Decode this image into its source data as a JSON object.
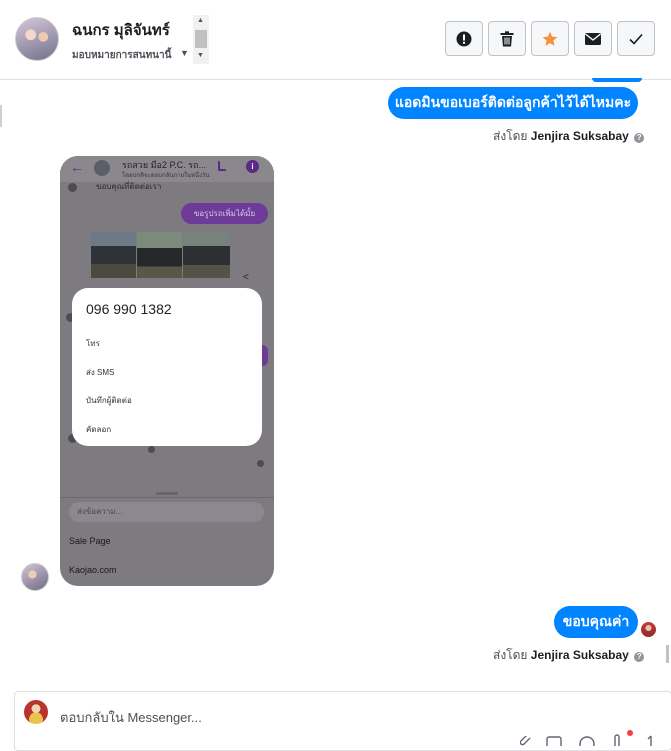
{
  "header": {
    "contact_name": "ฉนกร มุลิจันทร์",
    "assign_label": "มอบหมายการสนทนานี้"
  },
  "toolbar": {
    "buttons": [
      {
        "name": "spam-button",
        "icon": "alert-icon"
      },
      {
        "name": "delete-button",
        "icon": "trash-icon"
      },
      {
        "name": "star-button",
        "icon": "star-icon"
      },
      {
        "name": "mark-unread-button",
        "icon": "envelope-icon"
      },
      {
        "name": "done-button",
        "icon": "check-icon"
      }
    ],
    "star_color": "#f7923b"
  },
  "conversation": {
    "msg1": {
      "text": "แอดมินขอเบอร์ติดต่อลูกค้าไว้ได้ไหมคะ",
      "sent_by_prefix": "ส่งโดย",
      "sent_by_name": "Jenjira Suksabay",
      "info_glyph": "?"
    },
    "image": {
      "topbar_title": "รถสวย มือ2 P.C. รถ...",
      "topbar_sub": "โดยปกติจะตอบกลับภายในหนึ่งวัน",
      "top_line": "ขอบคุณที่ติดต่อเรา",
      "purple_msg": "ขอรูปรถเพิ่มได้มั้ย",
      "popup_number": "096 990 1382",
      "popup_options": [
        "โทร",
        "ส่ง SMS",
        "บันทึกผู้ติดต่อ",
        "คัดลอก"
      ],
      "input_placeholder": "ส่งข้อความ...",
      "link1": "Sale Page",
      "link2": "Kaojao.com"
    },
    "msg2": {
      "text": "ขอบคุณค่า",
      "sent_by_prefix": "ส่งโดย",
      "sent_by_name": "Jenjira Suksabay",
      "info_glyph": "?"
    },
    "bubble_color": "#0084ff"
  },
  "reply": {
    "placeholder": "ตอบกลับใน Messenger..."
  }
}
